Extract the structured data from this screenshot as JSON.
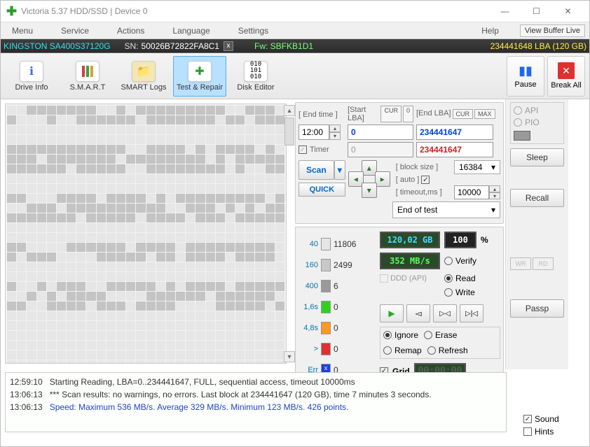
{
  "window": {
    "title": "Victoria 5.37 HDD/SSD | Device 0"
  },
  "menu": {
    "items": [
      "Menu",
      "Service",
      "Actions",
      "Language",
      "Settings"
    ],
    "help": "Help",
    "viewbuf": "View Buffer Live"
  },
  "device": {
    "name": "KINGSTON SA400S37120G",
    "sn_label": "SN:",
    "sn": "50026B72822FA8C1",
    "fw_label": "Fw:",
    "fw": "SBFKB1D1",
    "lba": "234441648 LBA (120 GB)"
  },
  "toolbar": {
    "drive_info": "Drive Info",
    "smart": "S.M.A.R.T",
    "smart_logs": "SMART Logs",
    "test_repair": "Test & Repair",
    "disk_editor": "Disk Editor",
    "pause": "Pause",
    "break_all": "Break All"
  },
  "scan": {
    "end_time_label": "[ End time ]",
    "end_time_val": "12:00",
    "timer_label": "Timer",
    "timer_val": "0",
    "start_lba_label": "[Start LBA]",
    "start_lba": "0",
    "start_cur": "CUR",
    "start_0": "0",
    "end_lba_label": "[End LBA]",
    "end_lba": "234441647",
    "end_cur": "CUR",
    "end_max": "MAX",
    "end_lba_red": "234441647",
    "block_size_label": "[ block size ]",
    "auto_label": "[ auto ]",
    "block_size": "16384",
    "timeout_label": "[ timeout,ms ]",
    "timeout": "10000",
    "scan_btn": "Scan",
    "quick_btn": "QUICK",
    "end_of_test": "End of test"
  },
  "stats": {
    "legend": [
      {
        "thresh": "40",
        "color": "#e6e6e6",
        "count": "11806"
      },
      {
        "thresh": "160",
        "color": "#c8c8c8",
        "count": "2499"
      },
      {
        "thresh": "400",
        "color": "#9a9a9a",
        "count": "6"
      },
      {
        "thresh": "1,6s",
        "color": "#30d020",
        "count": "0"
      },
      {
        "thresh": "4,8s",
        "color": "#ff9820",
        "count": "0"
      },
      {
        "thresh": ">",
        "color": "#e03030",
        "count": "0"
      },
      {
        "thresh": "Err",
        "color": "#2040e0",
        "count": "0",
        "x": true
      }
    ],
    "capacity": "120,02 GB",
    "speed": "352 MB/s",
    "percent": "100",
    "percent_sym": "%",
    "ddd_label": "DDD (API)",
    "verify": "Verify",
    "read": "Read",
    "write": "Write",
    "ignore": "Ignore",
    "erase": "Erase",
    "remap": "Remap",
    "refresh": "Refresh",
    "grid": "Grid",
    "clock": "00:00:00"
  },
  "side": {
    "api": "API",
    "pio": "PIO",
    "sleep": "Sleep",
    "recall": "Recall",
    "passp": "Passp",
    "wr": "WR",
    "rd": "RD",
    "sound": "Sound",
    "hints": "Hints"
  },
  "log": [
    {
      "ts": "12:59:10",
      "msg": "Starting Reading, LBA=0..234441647, FULL, sequential access, timeout 10000ms"
    },
    {
      "ts": "13:06:13",
      "msg": "*** Scan results: no warnings, no errors. Last block at 234441647 (120 GB), time 7 minutes 3 seconds."
    },
    {
      "ts": "13:06:13",
      "msg": "Speed: Maximum 536 MB/s. Average 329 MB/s. Minimum 123 MB/s. 426 points.",
      "blue": true
    }
  ]
}
